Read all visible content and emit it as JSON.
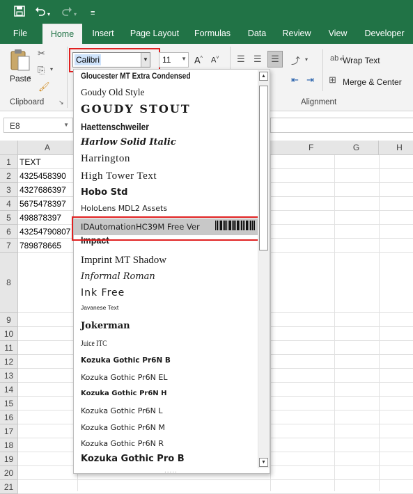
{
  "titlebar": {
    "icons": [
      "save-icon",
      "undo-icon",
      "redo-icon",
      "customize-icon"
    ]
  },
  "tabs": [
    "File",
    "Home",
    "Insert",
    "Page Layout",
    "Formulas",
    "Data",
    "Review",
    "View",
    "Developer"
  ],
  "active_tab": "Home",
  "ribbon": {
    "paste_label": "Paste",
    "clipboard_label": "Clipboard",
    "alignment_label": "Alignment",
    "font_name": "Calibri",
    "font_size": "11",
    "wrap_text_label": "Wrap Text",
    "merge_center_label": "Merge & Center",
    "grow_font": "A^",
    "shrink_font": "A˅"
  },
  "name_box": "E8",
  "grid": {
    "columns": [
      "A",
      "F",
      "G",
      "H"
    ],
    "rows": [
      "1",
      "2",
      "3",
      "4",
      "5",
      "6",
      "7",
      "8",
      "9",
      "10",
      "11",
      "12",
      "13",
      "14",
      "15",
      "16",
      "17",
      "18",
      "19",
      "20",
      "21"
    ],
    "cells": [
      "TEXT",
      "4325458390",
      "4327686397",
      "5675478397",
      "498878397",
      "43254790807",
      "789878665"
    ]
  },
  "font_list": {
    "items": [
      "Gloucester MT Extra Condensed",
      "Goudy Old Style",
      "GOUDY STOUT",
      "Haettenschweiler",
      "Harlow Solid Italic",
      "Harrington",
      "High Tower Text",
      "Hobo Std",
      "HoloLens MDL2 Assets",
      "IDAutomationHC39M Free Ver",
      "Impact",
      "Imprint MT Shadow",
      "Informal Roman",
      "Ink Free",
      "Javanese Text",
      "Jokerman",
      "Juice ITC",
      "Kozuka Gothic Pr6N B",
      "Kozuka Gothic Pr6N EL",
      "Kozuka Gothic Pr6N H",
      "Kozuka Gothic Pr6N L",
      "Kozuka Gothic Pr6N M",
      "Kozuka Gothic Pr6N R",
      "Kozuka Gothic Pro B"
    ],
    "selected": "IDAutomationHC39M Free Ver",
    "grip": "....."
  },
  "colors": {
    "excel_green": "#217346",
    "highlight_border": "#e02020",
    "selected_row": "#c8c8c8"
  }
}
